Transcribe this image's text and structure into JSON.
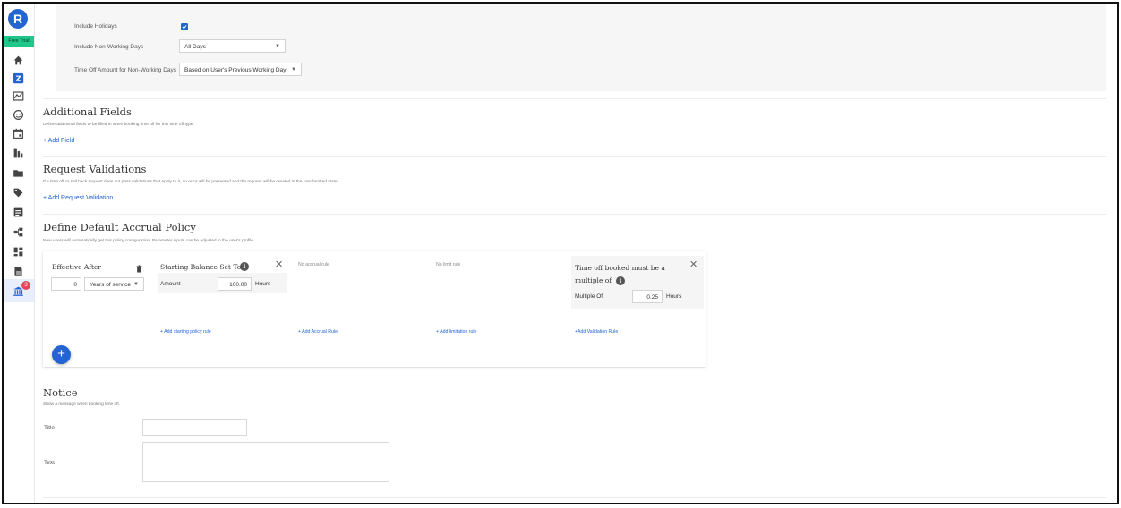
{
  "sidebar": {
    "logo_letter": "R",
    "free_trial": "Free Trial",
    "icons": [
      "home-icon",
      "zoho-app-icon",
      "analytics-icon",
      "time-off-icon",
      "calendar-icon",
      "reports-icon",
      "folder-icon",
      "tag-icon",
      "list-icon",
      "org-chart-icon",
      "dashboard-icon",
      "document-icon",
      "bank-icon"
    ],
    "badge_count": "3"
  },
  "settings": {
    "include_holidays_label": "Include Holidays",
    "include_holidays_checked": true,
    "non_working_days_label": "Include Non-Working Days",
    "non_working_days_value": "All Days",
    "time_off_amount_label": "Time Off Amount for Non-Working Days",
    "time_off_amount_value": "Based on User's Previous Working Day"
  },
  "additional_fields": {
    "title": "Additional Fields",
    "description": "Define additional fields to be filled in when booking time off for this time off type.",
    "add_link": "+ Add Field"
  },
  "request_validations": {
    "title": "Request Validations",
    "description": "If a time off or sell back request does not pass validations that apply to it, an error will be presented and the request will be created in the unsubmitted state.",
    "add_link": "+ Add Request Validation"
  },
  "accrual_policy": {
    "title": "Define Default Accrual Policy",
    "description": "New users will automatically get this policy configuration. Parameter inputs can be adjusted in the user's profile.",
    "effective_after": {
      "heading": "Effective After",
      "value": "0",
      "unit": "Years of service"
    },
    "starting_balance": {
      "heading": "Starting Balance Set To",
      "amount_label": "Amount",
      "amount_value": "100.00",
      "unit": "Hours",
      "add_link": "+ Add starting policy rule"
    },
    "accrual": {
      "note": "No accrual rule",
      "add_link": "+ Add Accrual Rule"
    },
    "limit": {
      "note": "No limit rule",
      "add_link": "+ Add limitation rule"
    },
    "validation": {
      "heading_line1": "Time off booked must be a",
      "heading_line2": "multiple of",
      "multiple_label": "Multiple Of",
      "multiple_value": "0.25",
      "unit": "Hours",
      "add_link": "+Add Validation Rule"
    },
    "fab_label": "+"
  },
  "notice": {
    "title": "Notice",
    "description": "Show a message when booking time off.",
    "title_label": "Title",
    "text_label": "Text"
  },
  "colors": {
    "accent": "#2364d2",
    "free_trial": "#1fc78b",
    "badge": "#e8455a"
  }
}
